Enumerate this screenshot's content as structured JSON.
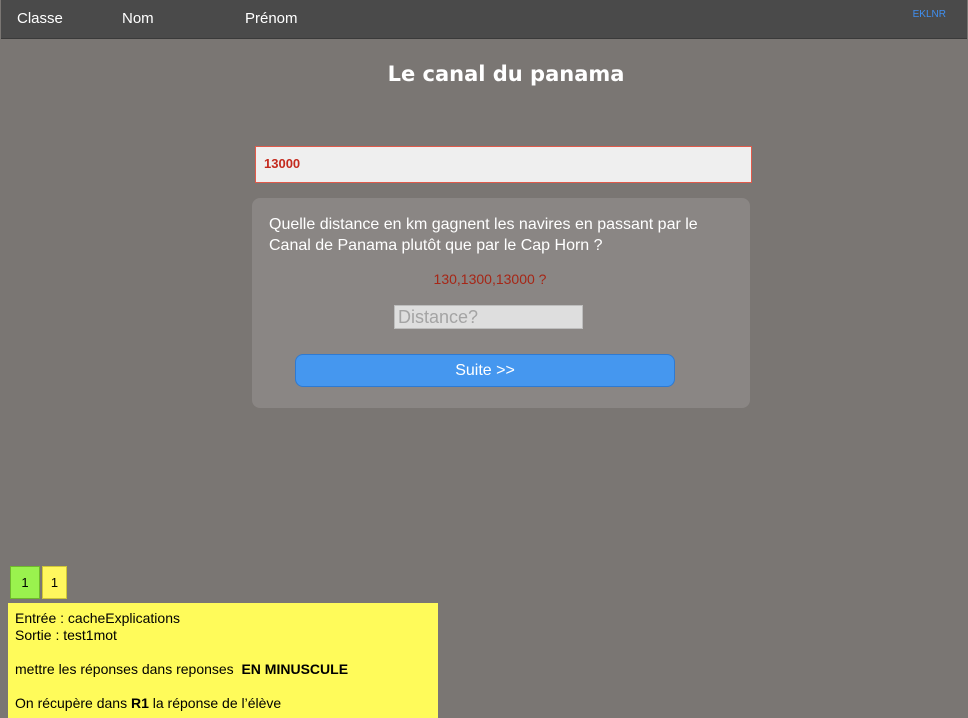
{
  "header": {
    "col_classe": "Classe",
    "col_nom": "Nom",
    "col_prenom": "Prénom",
    "code": "EKLNR"
  },
  "title": "Le canal du panama",
  "answer": {
    "value": "13000"
  },
  "card": {
    "question": "Quelle distance en km gagnent les navires en passant par le Canal de Panama plutôt que par le Cap Horn ?",
    "hint": "130,1300,13000 ?",
    "input_placeholder": "Distance?",
    "button_label": "Suite >>"
  },
  "badges": {
    "green": "1",
    "yellow": "1"
  },
  "notes": {
    "line1": "Entrée : cacheExplications",
    "line2": "Sortie : test1mot",
    "line3_prefix": "mettre les réponses dans reponses  ",
    "line3_bold": "EN MINUSCULE",
    "line4_prefix": "On récupère dans ",
    "line4_bold": "R1",
    "line4_suffix": " la réponse de l’élève"
  },
  "colors": {
    "background": "#7a7673",
    "topbar": "#4a4a4a",
    "accent_blue": "#4597ef",
    "answer_red": "#c42a1e",
    "note_yellow": "#fffb5a",
    "badge_green": "#9af24e"
  }
}
